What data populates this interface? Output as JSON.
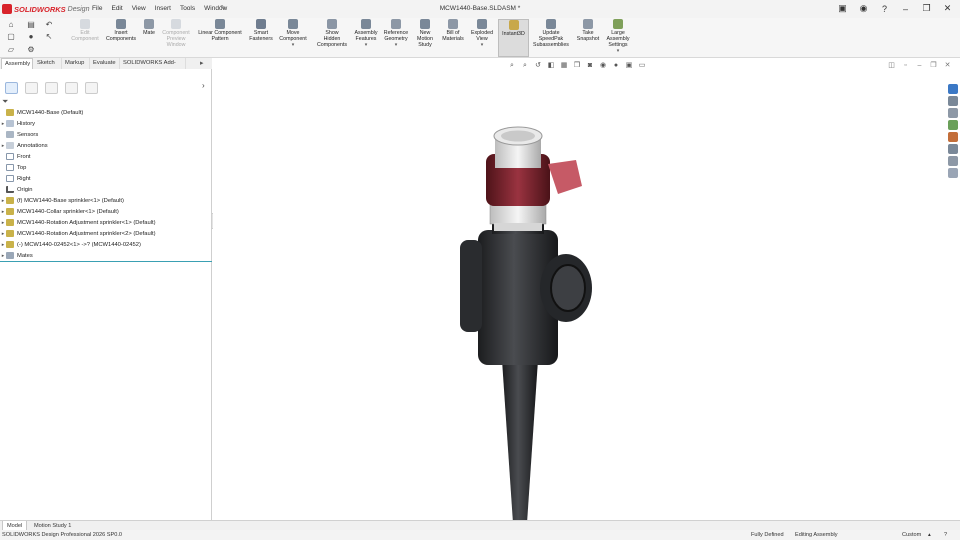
{
  "app": {
    "brand": "SOLIDWORKS",
    "edition": "Design",
    "document_title": "MCW1440-Base.SLDASM *",
    "menus": [
      "File",
      "Edit",
      "View",
      "Insert",
      "Tools",
      "Window"
    ]
  },
  "ribbon": {
    "commands": [
      {
        "label": "Edit\nComponent",
        "disabled": true
      },
      {
        "label": "Insert\nComponents",
        "disabled": false
      },
      {
        "label": "Mate",
        "disabled": false
      },
      {
        "label": "Component\nPreview\nWindow",
        "disabled": true
      },
      {
        "label": "Linear Component\nPattern",
        "disabled": false
      },
      {
        "label": "Smart\nFasteners",
        "disabled": false
      },
      {
        "label": "Move\nComponent",
        "disabled": false
      },
      {
        "label": "Show\nHidden\nComponents",
        "disabled": false
      },
      {
        "label": "Assembly\nFeatures",
        "disabled": false
      },
      {
        "label": "Reference\nGeometry",
        "disabled": false
      },
      {
        "label": "New\nMotion\nStudy",
        "disabled": false
      },
      {
        "label": "Bill of\nMaterials",
        "disabled": false
      },
      {
        "label": "Exploded\nView",
        "disabled": false
      },
      {
        "label": "Instant3D",
        "disabled": false,
        "active": true
      },
      {
        "label": "Update\nSpeedPak\nSubassemblies",
        "disabled": false
      },
      {
        "label": "Take\nSnapshot",
        "disabled": false
      },
      {
        "label": "Large\nAssembly\nSettings",
        "disabled": false
      }
    ]
  },
  "command_tabs": [
    "Assembly",
    "Sketch",
    "Markup",
    "Evaluate",
    "SOLIDWORKS Add-Ins"
  ],
  "tree": {
    "root": "MCW1440-Base  (Default)",
    "items": [
      {
        "label": "History",
        "expander": true
      },
      {
        "label": "Sensors",
        "expander": false
      },
      {
        "label": "Annotations",
        "expander": true
      },
      {
        "label": "Front",
        "expander": false
      },
      {
        "label": "Top",
        "expander": false
      },
      {
        "label": "Right",
        "expander": false
      },
      {
        "label": "Origin",
        "expander": false
      },
      {
        "label": "(f) MCW1440-Base sprinkler<1> (Default)",
        "expander": true
      },
      {
        "label": "MCW1440-Collar sprinkler<1> (Default)",
        "expander": true
      },
      {
        "label": "MCW1440-Rotation Adjustment sprinkler<1> (Default)",
        "expander": true
      },
      {
        "label": "MCW1440-Rotation Adjustment sprinkler<2> (Default)",
        "expander": true
      },
      {
        "label": "(-) MCW1440-02452<1> ->? (MCW1440-02452)",
        "expander": true
      },
      {
        "label": "Mates",
        "expander": true
      }
    ]
  },
  "bottom_tabs": [
    "Model",
    "Motion Study 1"
  ],
  "status": {
    "product": "SOLIDWORKS Design Professional 2026 SP0.0",
    "state": "Fully Defined",
    "mode": "Editing Assembly",
    "units": "Custom"
  },
  "colors": {
    "accent": "#d8232a",
    "part_body": "#2b2d30",
    "collar": "#7a1f28",
    "selection_line": "#3aa0b3"
  }
}
